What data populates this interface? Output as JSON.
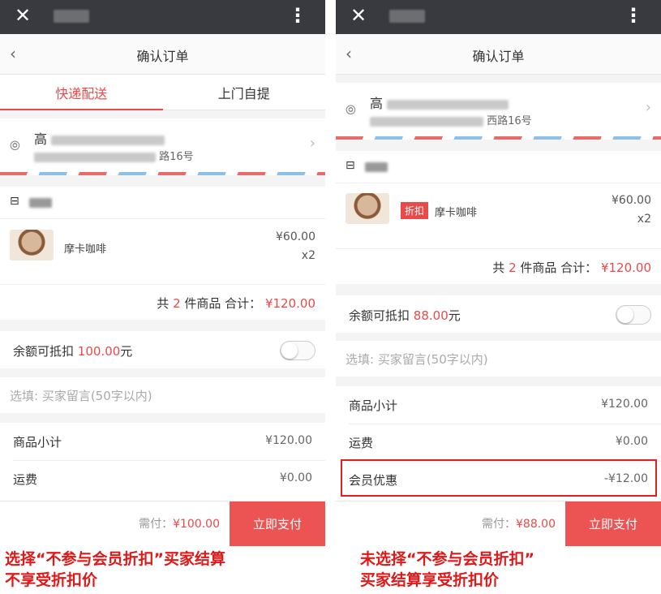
{
  "left": {
    "nav_title": "确认订单",
    "tabs": {
      "express": "快递配送",
      "pickup": "上门自提"
    },
    "address": {
      "name_prefix": "高",
      "address_suffix": "路16号"
    },
    "product": {
      "name": "摩卡咖啡",
      "price": "¥60.00",
      "qty": "x2"
    },
    "total": {
      "prefix": "共",
      "count": "2",
      "middle": "件商品 合计：",
      "amount": "¥120.00"
    },
    "balance": {
      "label": "余额可抵扣",
      "amount": "100.00",
      "unit": "元"
    },
    "message_placeholder": "选填: 买家留言(50字以内)",
    "summary": [
      {
        "label": "商品小计",
        "value": "¥120.00"
      },
      {
        "label": "运费",
        "value": "¥0.00"
      }
    ],
    "payment": {
      "label": "需付：",
      "amount": "¥100.00",
      "button": "立即支付"
    },
    "caption": "选择“不参与会员折扣”买家结算\n不享受折扣价"
  },
  "right": {
    "nav_title": "确认订单",
    "address": {
      "name_prefix": "高",
      "address_suffix": "西路16号"
    },
    "product": {
      "tag": "折扣",
      "name": "摩卡咖啡",
      "price": "¥60.00",
      "qty": "x2"
    },
    "total": {
      "prefix": "共",
      "count": "2",
      "middle": "件商品 合计：",
      "amount": "¥120.00"
    },
    "balance": {
      "label": "余额可抵扣",
      "amount": "88.00",
      "unit": "元"
    },
    "message_placeholder": "选填: 买家留言(50字以内)",
    "summary": [
      {
        "label": "商品小计",
        "value": "¥120.00"
      },
      {
        "label": "运费",
        "value": "¥0.00"
      },
      {
        "label": "会员优惠",
        "value": "-¥12.00"
      }
    ],
    "payment": {
      "label": "需付：",
      "amount": "¥88.00",
      "button": "立即支付"
    },
    "caption": "未选择“不参与会员折扣”\n买家结算享受折扣价"
  },
  "colors": {
    "accent": "#e84a4a",
    "topbar": "#393a3f",
    "caption": "#e01818"
  },
  "icons": [
    "close-icon",
    "more-vertical-icon",
    "back-chevron-icon",
    "location-pin-icon",
    "chevron-right-icon",
    "store-icon"
  ]
}
